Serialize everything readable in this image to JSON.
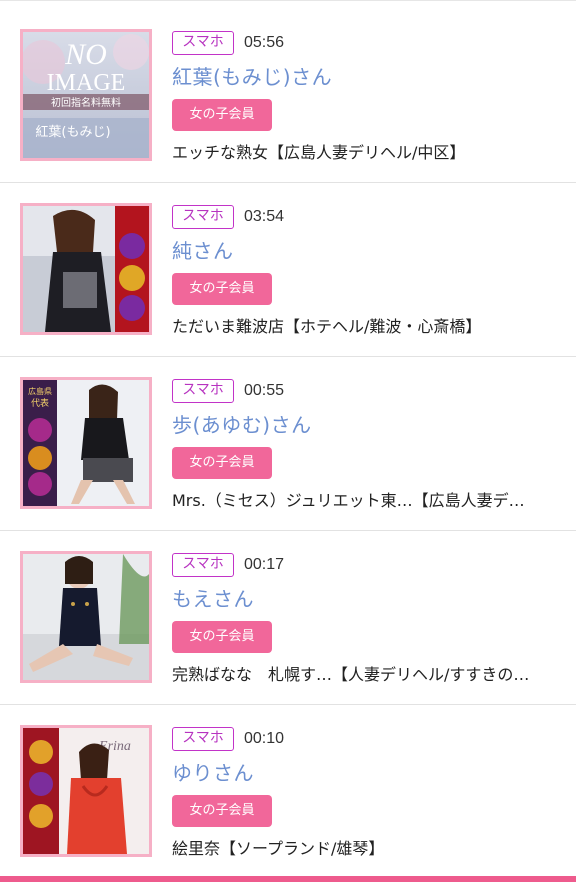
{
  "entries": [
    {
      "device": "スマホ",
      "time": "05:56",
      "name": "紅葉(もみじ)さん",
      "badge": "女の子会員",
      "shop": "エッチな熟女【広島人妻デリヘル/中区】",
      "thumb_text": [
        "NO",
        "IMAGE",
        "初回指名料無料",
        "紅葉(もみじ)"
      ]
    },
    {
      "device": "スマホ",
      "time": "03:54",
      "name": "純さん",
      "badge": "女の子会員",
      "shop": "ただいま難波店【ホテヘル/難波・心斎橋】"
    },
    {
      "device": "スマホ",
      "time": "00:55",
      "name": "歩(あゆむ)さん",
      "badge": "女の子会員",
      "shop": "Mrs.（ミセス）ジュリエット東…【広島人妻デ…",
      "thumb_text": [
        "広島県",
        "代表"
      ]
    },
    {
      "device": "スマホ",
      "time": "00:17",
      "name": "もえさん",
      "badge": "女の子会員",
      "shop": "完熟ばなな　札幌す…【人妻デリヘル/すすきの…"
    },
    {
      "device": "スマホ",
      "time": "00:10",
      "name": "ゆりさん",
      "badge": "女の子会員",
      "shop": "絵里奈【ソープランド/雄琴】",
      "thumb_text": [
        "Erina"
      ]
    }
  ],
  "colors": {
    "device_border": "#c233c8",
    "name": "#6c8fd0",
    "badge_bg": "#f1679a",
    "thumb_border": "#f6b0c6",
    "bottom_bar": "#ee5b8d"
  }
}
